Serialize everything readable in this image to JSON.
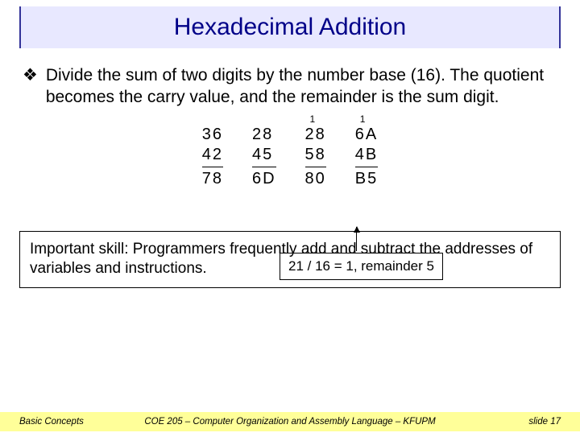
{
  "title": "Hexadecimal Addition",
  "bullet": "Divide the sum of two digits by the number base (16). The quotient becomes the carry value, and the remainder is the sum digit.",
  "columns": [
    {
      "carry": "",
      "r1": "36",
      "r2": "42",
      "r3": "78"
    },
    {
      "carry": "",
      "r1": "28",
      "r2": "45",
      "r3": "6D"
    },
    {
      "carry": "1",
      "r1": "28",
      "r2": "58",
      "r3": "80"
    },
    {
      "carry": "1",
      "r1": "6A",
      "r2": "4B",
      "r3": "B5"
    }
  ],
  "calc": "21 / 16 = 1, remainder 5",
  "note": "Important skill: Programmers frequently add and subtract the addresses of variables and instructions.",
  "footer": {
    "left": "Basic Concepts",
    "center": "COE 205 – Computer Organization and Assembly Language – KFUPM",
    "right": "slide 17"
  }
}
